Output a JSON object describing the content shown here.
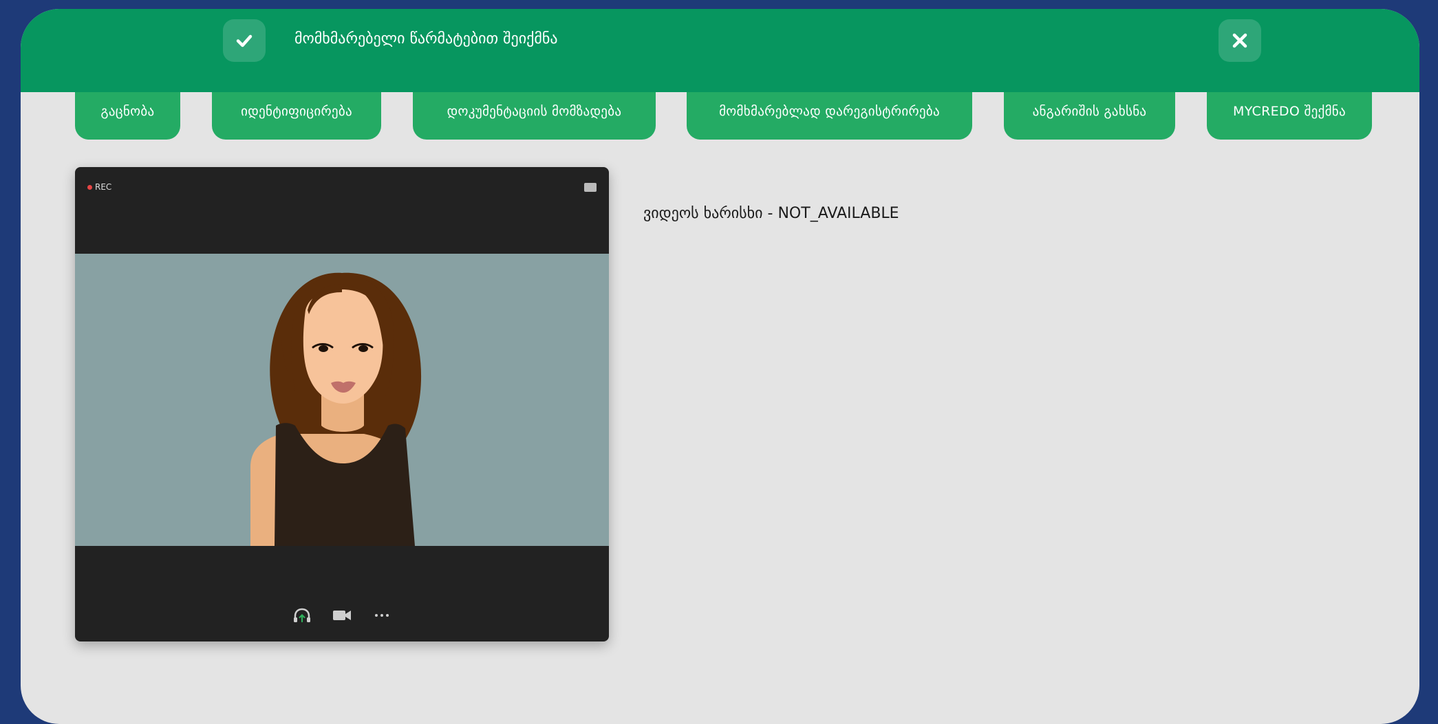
{
  "toast": {
    "message": "მომხმარებელი წარმატებით შეიქმნა",
    "icon": "check-icon",
    "close_icon": "close-icon"
  },
  "steps": [
    {
      "label": "გაცნობა"
    },
    {
      "label": "იდენტიფიცირება"
    },
    {
      "label": "დოკუმენტაციის მომზადება"
    },
    {
      "label": "მომხმარებლად დარეგისტრირება"
    },
    {
      "label": "ანგარიშის გახსნა"
    },
    {
      "label": "MYCREDO შექმნა"
    }
  ],
  "video": {
    "rec_label": "REC",
    "controls": [
      "headset-icon",
      "camera-icon",
      "more-icon"
    ]
  },
  "quality_text": "ვიდეოს ხარისხი - NOT_AVAILABLE",
  "colors": {
    "page_background": "#1e3a78",
    "toast_green": "#07965f",
    "step_green": "#24ab64",
    "card_background": "#e4e4e4"
  }
}
